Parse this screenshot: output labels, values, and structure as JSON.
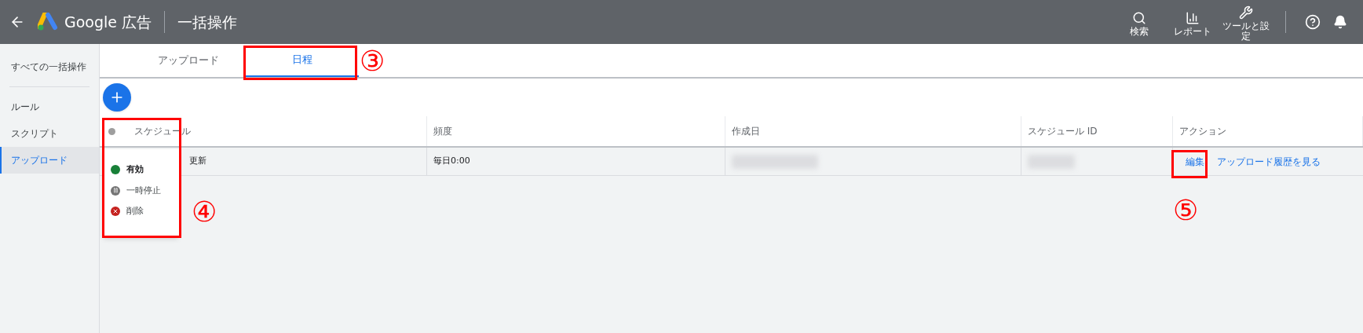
{
  "header": {
    "brand": "Google 広告",
    "title": "一括操作",
    "actions": [
      {
        "kind": "search",
        "label": "検索"
      },
      {
        "kind": "report",
        "label": "レポート"
      },
      {
        "kind": "tools",
        "label": "ツールと設定"
      }
    ]
  },
  "sidebar": {
    "items": [
      {
        "label": "すべての一括操作",
        "selected": false
      },
      {
        "label": "ルール",
        "selected": false
      },
      {
        "label": "スクリプト",
        "selected": false
      },
      {
        "label": "アップロード",
        "selected": true
      }
    ]
  },
  "tabs": [
    {
      "label": "アップロード",
      "selected": false
    },
    {
      "label": "日程",
      "selected": true
    }
  ],
  "table": {
    "columns": [
      "スケジュール",
      "頻度",
      "作成日",
      "スケジュール ID",
      "アクション"
    ],
    "rows": [
      {
        "schedule": "更新",
        "frequency": "毎日0:00",
        "actions": [
          "編集",
          "アップロード履歴を見る"
        ]
      }
    ]
  },
  "status_menu": [
    {
      "kind": "enabled",
      "label": "有効",
      "selected": true
    },
    {
      "kind": "paused",
      "label": "一時停止",
      "selected": false
    },
    {
      "kind": "removed",
      "label": "削除",
      "selected": false
    }
  ],
  "annotations": [
    "③",
    "④",
    "⑤"
  ]
}
